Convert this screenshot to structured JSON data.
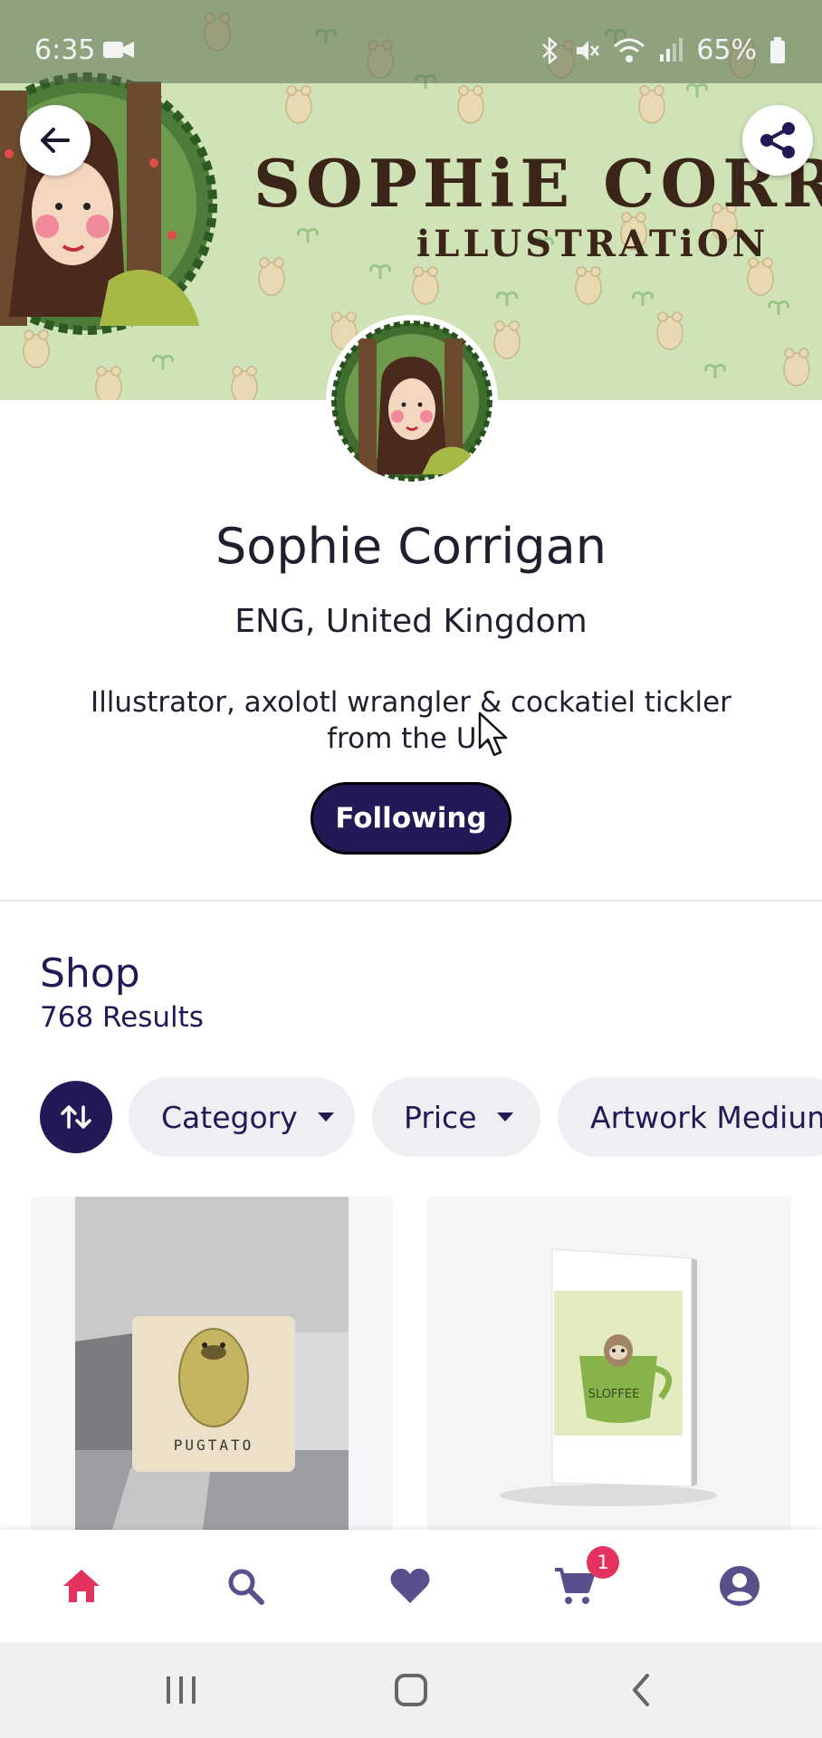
{
  "status_bar": {
    "time": "6:35",
    "battery": "65%",
    "icons": [
      "video-camera-icon",
      "bluetooth-icon",
      "mute-icon",
      "wifi-icon",
      "signal-icon",
      "battery-icon"
    ]
  },
  "banner": {
    "title": "SOPHiE CORRiGA",
    "subtitle": "iLLUSTRATiON",
    "background_color": "#cfe3b6",
    "lettering_color": "#3b2418"
  },
  "header_actions": {
    "back_icon": "arrow-left-icon",
    "share_icon": "share-icon"
  },
  "profile": {
    "name": "Sophie Corrigan",
    "location": "ENG, United Kingdom",
    "bio": "Illustrator, axolotl wrangler & cockatiel tickler from the UK",
    "follow_label": "Following"
  },
  "shop": {
    "title": "Shop",
    "results": "768 Results",
    "sort_icon": "sort-arrows-icon",
    "filters": [
      {
        "label": "Category"
      },
      {
        "label": "Price"
      },
      {
        "label": "Artwork Medium"
      }
    ],
    "products": [
      {
        "image_text": "PUGTATO",
        "kind": "throw pillow"
      },
      {
        "image_text": "SLOFFEE",
        "kind": "greeting card"
      }
    ]
  },
  "bottom_nav": {
    "items": [
      {
        "icon": "home-icon",
        "active": true
      },
      {
        "icon": "search-icon",
        "active": false
      },
      {
        "icon": "heart-icon",
        "active": false
      },
      {
        "icon": "cart-icon",
        "active": false,
        "badge": "1"
      },
      {
        "icon": "account-icon",
        "active": false
      }
    ],
    "active_color": "#e4325f",
    "inactive_color": "#5a4f8c"
  },
  "colors": {
    "primary": "#221a56",
    "accent": "#e4325f",
    "chip_bg": "#eeeff3"
  }
}
